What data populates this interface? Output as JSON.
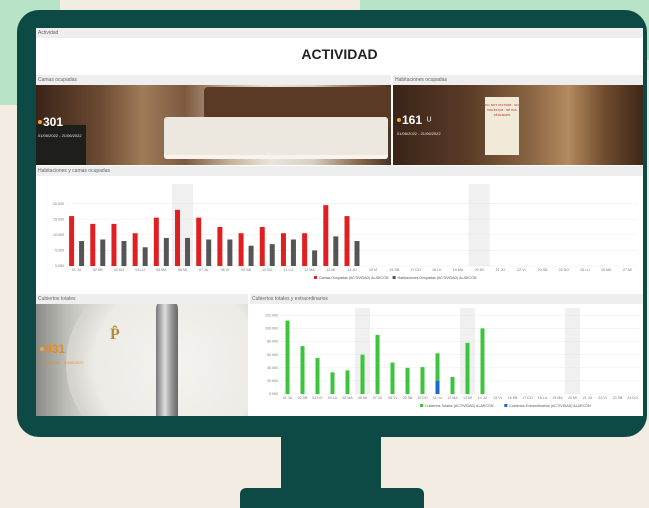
{
  "dashboard": {
    "breadcrumb": "Actividad",
    "title": "ACTIVIDAD"
  },
  "panels": {
    "camas": {
      "title": "Camas ocupadas",
      "kpi_value": "301",
      "kpi_dates": "01/06/2022 - 21/06/2022"
    },
    "habitaciones": {
      "title": "Habitaciones ocupadas",
      "kpi_value": "161",
      "kpi_unit": "U",
      "kpi_dates": "01/06/2022 - 21/06/2022",
      "sign_text": "DO NOT DISTURB · NO MOLESTAR · NE PAS DÉRANGER"
    },
    "hab_camas_chart": {
      "title": "Habitaciones y camas ocupadas"
    },
    "cubiertos": {
      "title": "Cubiertos totales",
      "kpi_value": "931",
      "kpi_dates": "01/06/2022 - 21/06/2022"
    },
    "cubiertos_chart": {
      "title": "Cubiertos totales y extraordinarios"
    }
  },
  "chart_data": [
    {
      "type": "bar",
      "title": "Habitaciones y camas ocupadas",
      "categories": [
        "01 JU",
        "02 SB",
        "03 DO",
        "04 LU",
        "05 MA",
        "06 MI",
        "07 JU",
        "08 VI",
        "09 SB",
        "10 DO",
        "11 LU",
        "12 MA",
        "13 MI",
        "14 JU",
        "15 VI",
        "16 SB",
        "17 DO",
        "18 LU",
        "19 MA",
        "20 MI",
        "21 JU",
        "22 VI",
        "23 SB",
        "24 DO",
        "25 LU",
        "26 MA",
        "27 MI"
      ],
      "ylim": [
        0,
        25000
      ],
      "yticks": [
        0,
        5000,
        10000,
        15000,
        20000
      ],
      "ytick_labels": [
        "0.000",
        "5.000",
        "10.000",
        "15.000",
        "20.000"
      ],
      "series": [
        {
          "name": "Camas Ocupadas (ACTIVIDAD) ALARCÓN",
          "color": "#e02020",
          "values": [
            16000,
            13500,
            13500,
            10500,
            15500,
            18000,
            15500,
            12500,
            10500,
            12500,
            10500,
            10500,
            19500,
            16000,
            null,
            null,
            null,
            null,
            null,
            null,
            null,
            null,
            null,
            null,
            null,
            null,
            null
          ]
        },
        {
          "name": "Habitaciones Ocupadas (ACTIVIDAD) ALARCÓN",
          "color": "#555555",
          "values": [
            8000,
            8500,
            8000,
            6000,
            9000,
            9000,
            8500,
            8500,
            6500,
            7000,
            8500,
            5000,
            9500,
            8000,
            null,
            null,
            null,
            null,
            null,
            null,
            null,
            null,
            null,
            null,
            null,
            null,
            null
          ]
        }
      ],
      "shaded_categories": [
        "06 MI",
        "20 MI"
      ],
      "legend": "bottom"
    },
    {
      "type": "bar",
      "title": "Cubiertos totales y extraordinarios",
      "categories": [
        "01 JU",
        "02 SB",
        "03 DO",
        "04 LU",
        "05 MA",
        "06 MI",
        "07 JU",
        "08 VI",
        "09 SB",
        "10 DO",
        "11 LU",
        "12 MA",
        "13 MI",
        "14 JU",
        "15 VI",
        "16 SB",
        "17 DO",
        "18 LU",
        "19 MA",
        "20 MI",
        "21 JU",
        "22 VI",
        "23 SB",
        "24 DO"
      ],
      "ylim": [
        0,
        125000
      ],
      "yticks": [
        0,
        20000,
        40000,
        60000,
        80000,
        100000,
        120000
      ],
      "ytick_labels": [
        "0.000",
        "20.000",
        "40.000",
        "60.000",
        "80.000",
        "100.000",
        "120.000"
      ],
      "series": [
        {
          "name": "Cubiertos Totales (ACTIVIDAD) ALARCÓN",
          "color": "#3cc43c",
          "values": [
            112000,
            73000,
            55000,
            33000,
            36000,
            60000,
            90000,
            48000,
            40000,
            41000,
            62000,
            26000,
            78000,
            100000,
            null,
            null,
            null,
            null,
            null,
            null,
            null,
            null,
            null,
            null
          ]
        },
        {
          "name": "Cubiertos Extraordinarios (ACTIVIDAD) ALARCÓN",
          "color": "#1f64d8",
          "values": [
            null,
            null,
            null,
            null,
            null,
            null,
            null,
            null,
            null,
            null,
            20000,
            null,
            null,
            null,
            null,
            null,
            null,
            null,
            null,
            null,
            null,
            null,
            null,
            null
          ]
        }
      ],
      "shaded_categories": [
        "06 MI",
        "13 MI",
        "20 MI"
      ],
      "legend": "bottom"
    }
  ]
}
